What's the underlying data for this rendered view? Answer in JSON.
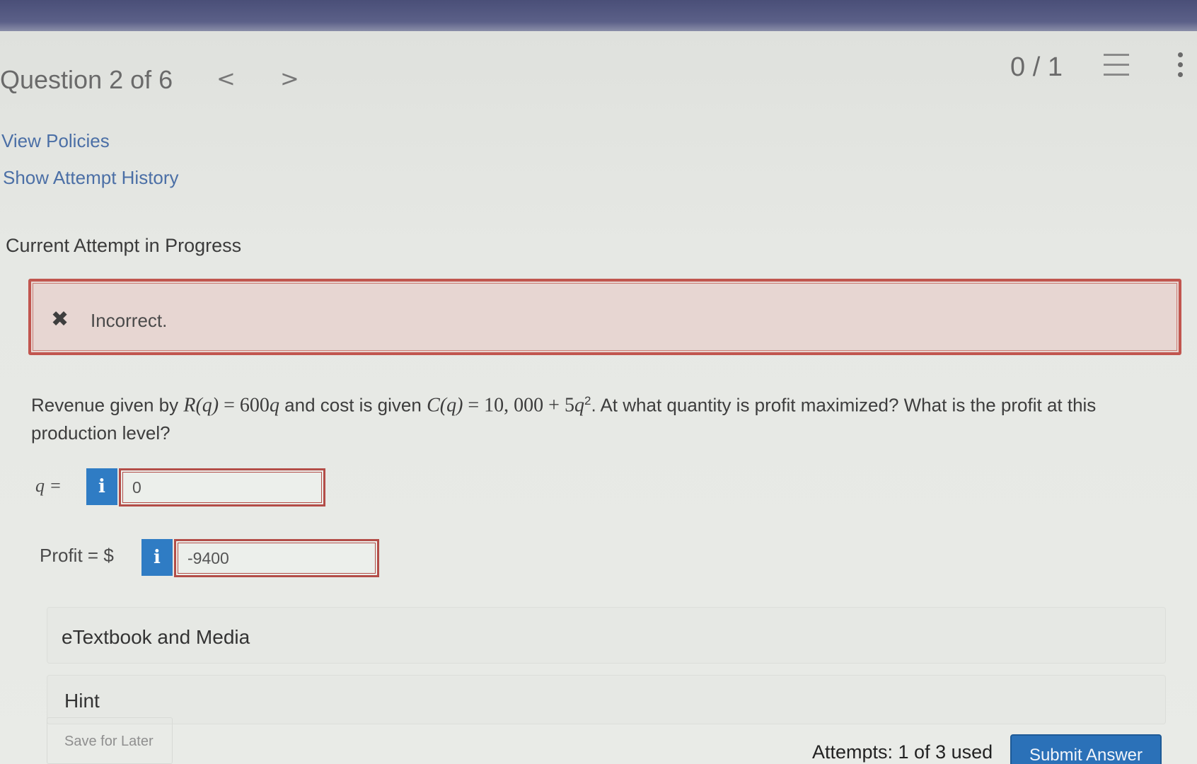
{
  "header": {
    "question_label": "Question 2 of 6",
    "prev_arrow": "<",
    "next_arrow": ">",
    "score": "0 / 1"
  },
  "links": {
    "view_policies": "View Policies",
    "show_attempt_history": "Show Attempt History"
  },
  "attempt_status": "Current Attempt in Progress",
  "feedback": {
    "icon": "x-mark-icon",
    "text": "Incorrect.",
    "color": "#c1564f"
  },
  "question": {
    "t1": "Revenue given by ",
    "m1": "R(q)",
    "t2": " = 600",
    "m2": "q",
    "t3": " and cost is given ",
    "m3": "C(q)",
    "t4": " = 10, 000 + 5",
    "m4": "q",
    "exp": "2",
    "t5": ". At what quantity is profit maximized? What is the profit at this production level?"
  },
  "answers": {
    "q_label": "q =",
    "q_value": "0",
    "profit_label": "Profit  =  $",
    "profit_value": "-9400",
    "info_glyph": "i"
  },
  "panels": {
    "etextbook": "eTextbook and Media",
    "hint": "Hint"
  },
  "footer": {
    "save_later": "Save for Later",
    "attempts": "Attempts: 1 of 3 used",
    "submit": "Submit Answer"
  },
  "colors": {
    "accent": "#2f7cc4",
    "error": "#b34d48",
    "link": "#4b6fa6"
  }
}
